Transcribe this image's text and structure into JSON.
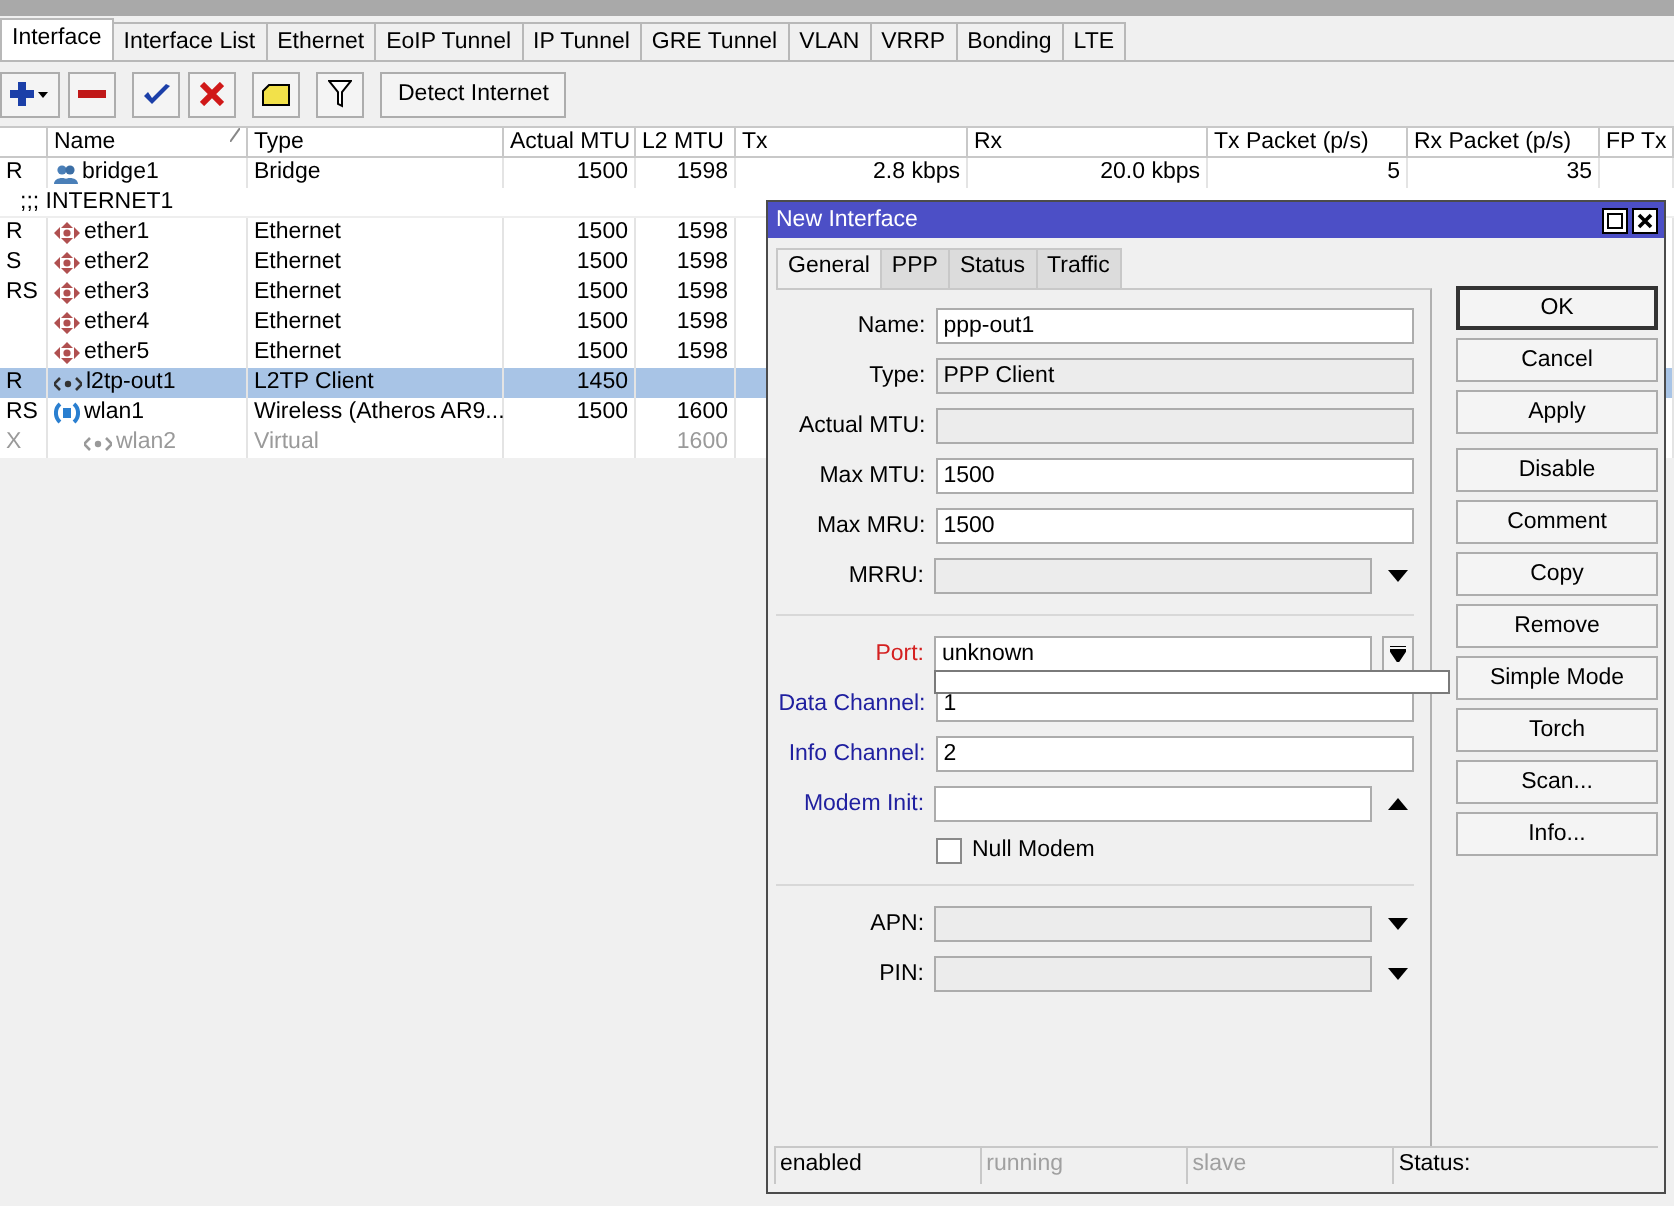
{
  "tabs": [
    {
      "label": "Interface",
      "selected": true
    },
    {
      "label": "Interface List",
      "selected": false
    },
    {
      "label": "Ethernet",
      "selected": false
    },
    {
      "label": "EoIP Tunnel",
      "selected": false
    },
    {
      "label": "IP Tunnel",
      "selected": false
    },
    {
      "label": "GRE Tunnel",
      "selected": false
    },
    {
      "label": "VLAN",
      "selected": false
    },
    {
      "label": "VRRP",
      "selected": false
    },
    {
      "label": "Bonding",
      "selected": false
    },
    {
      "label": "LTE",
      "selected": false
    }
  ],
  "toolbar": {
    "detect_button": "Detect Internet"
  },
  "table": {
    "columns": [
      "",
      "Name",
      "Type",
      "Actual MTU",
      "L2 MTU",
      "Tx",
      "Rx",
      "Tx Packet (p/s)",
      "Rx Packet (p/s)",
      "FP Tx"
    ],
    "rows": [
      {
        "kind": "bridge",
        "selected": false,
        "disabled": false,
        "cells": [
          "R",
          "bridge1",
          "Bridge",
          "1500",
          "1598",
          "2.8 kbps",
          "20.0 kbps",
          "5",
          "35"
        ]
      },
      {
        "kind": "comment",
        "cells": [
          ";;; INTERNET1"
        ]
      },
      {
        "kind": "ethernet",
        "selected": false,
        "disabled": false,
        "cells": [
          "R",
          "ether1",
          "Ethernet",
          "1500",
          "1598"
        ]
      },
      {
        "kind": "ethernet",
        "selected": false,
        "disabled": false,
        "cells": [
          "S",
          "ether2",
          "Ethernet",
          "1500",
          "1598"
        ]
      },
      {
        "kind": "ethernet",
        "selected": false,
        "disabled": false,
        "cells": [
          "RS",
          "ether3",
          "Ethernet",
          "1500",
          "1598"
        ]
      },
      {
        "kind": "ethernet",
        "selected": false,
        "disabled": false,
        "cells": [
          "",
          "ether4",
          "Ethernet",
          "1500",
          "1598"
        ]
      },
      {
        "kind": "ethernet",
        "selected": false,
        "disabled": false,
        "cells": [
          "",
          "ether5",
          "Ethernet",
          "1500",
          "1598"
        ]
      },
      {
        "kind": "tunnel",
        "selected": true,
        "disabled": false,
        "cells": [
          "R",
          "l2tp-out1",
          "L2TP Client",
          "1450",
          ""
        ]
      },
      {
        "kind": "wireless",
        "selected": false,
        "disabled": false,
        "cells": [
          "RS",
          "wlan1",
          "Wireless (Atheros AR9...",
          "1500",
          "1600"
        ]
      },
      {
        "kind": "virtual",
        "selected": false,
        "disabled": true,
        "cells": [
          "X",
          "wlan2",
          "Virtual",
          "",
          "1600"
        ]
      }
    ]
  },
  "dialog": {
    "title": "New Interface",
    "tabs": [
      {
        "label": "General",
        "selected": true
      },
      {
        "label": "PPP",
        "selected": false
      },
      {
        "label": "Status",
        "selected": false
      },
      {
        "label": "Traffic",
        "selected": false
      }
    ],
    "sections": [
      [
        {
          "kind": "text",
          "label": "Name:",
          "value": "ppp-out1"
        },
        {
          "kind": "readonly",
          "label": "Type:",
          "value": "PPP Client"
        },
        {
          "kind": "readonly",
          "label": "Actual MTU:"
        },
        {
          "kind": "text",
          "label": "Max MTU:",
          "value": "1500"
        },
        {
          "kind": "text",
          "label": "Max MRU:",
          "value": "1500"
        },
        {
          "kind": "dropdown",
          "label": "MRRU:"
        }
      ],
      [
        {
          "kind": "select",
          "label": "Port:",
          "value": "unknown",
          "color": "#d42020",
          "expanded": true
        },
        {
          "kind": "text",
          "label": "Data Channel:",
          "value": "1",
          "color": "#2020a0"
        },
        {
          "kind": "text",
          "label": "Info Channel:",
          "value": "2",
          "color": "#2020a0"
        },
        {
          "kind": "combo",
          "label": "Modem Init:",
          "color": "#2020a0"
        },
        {
          "kind": "checkbox",
          "label": "Null Modem",
          "checked": false
        }
      ],
      [
        {
          "kind": "dropdown",
          "label": "APN:"
        },
        {
          "kind": "dropdown",
          "label": "PIN:"
        }
      ]
    ],
    "buttons": [
      [
        {
          "label": "OK",
          "default": true
        },
        {
          "label": "Cancel",
          "default": false
        },
        {
          "label": "Apply",
          "default": false
        }
      ],
      [
        {
          "label": "Disable",
          "default": false
        },
        {
          "label": "Comment",
          "default": false
        },
        {
          "label": "Copy",
          "default": false
        },
        {
          "label": "Remove",
          "default": false
        },
        {
          "label": "Simple Mode",
          "default": false
        },
        {
          "label": "Torch",
          "default": false
        },
        {
          "label": "Scan...",
          "default": false
        },
        {
          "label": "Info...",
          "default": false
        }
      ]
    ],
    "status_bar": [
      {
        "text": "enabled",
        "disabled": false
      },
      {
        "text": "running",
        "disabled": true
      },
      {
        "text": "slave",
        "disabled": true
      },
      {
        "text": "Status:",
        "disabled": false
      }
    ]
  }
}
